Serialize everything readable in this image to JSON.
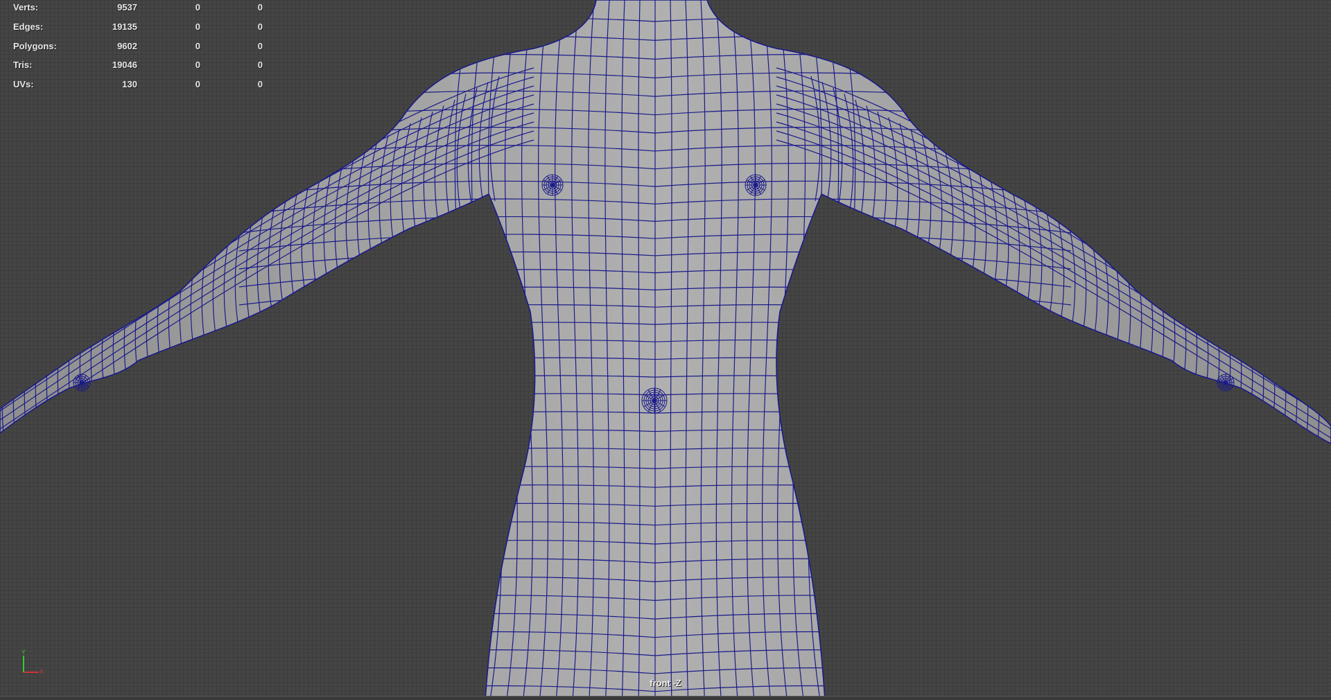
{
  "hud": {
    "rows": [
      {
        "label": "Verts:",
        "total": "9537",
        "selected": "0",
        "highlighted": "0"
      },
      {
        "label": "Edges:",
        "total": "19135",
        "selected": "0",
        "highlighted": "0"
      },
      {
        "label": "Polygons:",
        "total": "9602",
        "selected": "0",
        "highlighted": "0"
      },
      {
        "label": "Tris:",
        "total": "19046",
        "selected": "0",
        "highlighted": "0"
      },
      {
        "label": "UVs:",
        "total": "130",
        "selected": "0",
        "highlighted": "0"
      }
    ]
  },
  "viewport": {
    "camera_label": "front -Z",
    "wire_color": "#1a1a8a",
    "mesh_color": "#a3a3a3",
    "grid_color": "#454545"
  },
  "axis_gizmo": {
    "y_label": "Y",
    "x_label": "X",
    "y_color": "#33cc33",
    "x_color": "#cc3333"
  }
}
